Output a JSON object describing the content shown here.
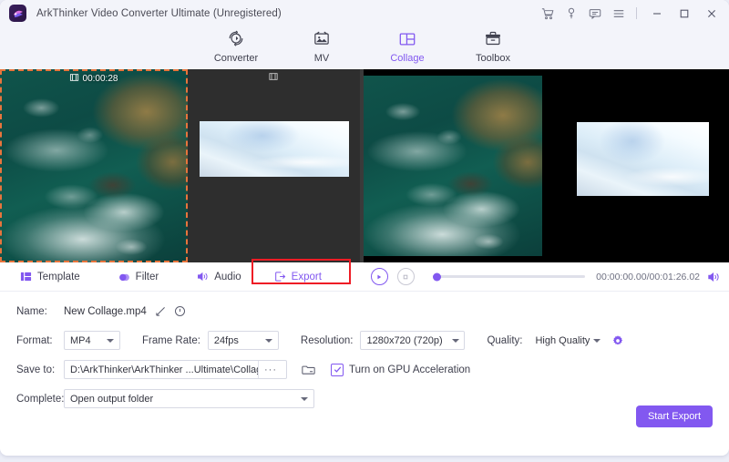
{
  "window": {
    "title": "ArkThinker Video Converter Ultimate (Unregistered)",
    "logo_icon": "arkthinker-logo-icon",
    "titlebar_icons": [
      {
        "name": "cart-icon",
        "label": "Cart"
      },
      {
        "name": "key-icon",
        "label": "Register"
      },
      {
        "name": "feedback-icon",
        "label": "Feedback"
      },
      {
        "name": "menu-icon",
        "label": "Menu"
      }
    ],
    "controls": [
      {
        "name": "minimize-button",
        "glyph": "—"
      },
      {
        "name": "maximize-button",
        "glyph": "▫"
      },
      {
        "name": "close-button",
        "glyph": "✕"
      }
    ]
  },
  "nav": {
    "items": [
      {
        "label": "Converter",
        "icon": "converter-icon",
        "active": false
      },
      {
        "label": "MV",
        "icon": "mv-icon",
        "active": false
      },
      {
        "label": "Collage",
        "icon": "collage-icon",
        "active": true
      },
      {
        "label": "Toolbox",
        "icon": "toolbox-icon",
        "active": false
      }
    ]
  },
  "preview": {
    "panes": [
      {
        "name": "pane-ocean-selected",
        "badge": "00:00:28",
        "badge_icon": "film-icon",
        "selected": true
      },
      {
        "name": "pane-sky-gray",
        "badge": "",
        "badge_icon": "film-icon",
        "selected": false
      },
      {
        "name": "pane-ocean-letterbox",
        "badge": "",
        "badge_icon": "",
        "selected": false
      },
      {
        "name": "pane-sky-black",
        "badge": "",
        "badge_icon": "",
        "selected": false
      }
    ]
  },
  "edit_tabs": [
    {
      "label": "Template",
      "icon": "template-icon",
      "active": false
    },
    {
      "label": "Filter",
      "icon": "filter-icon",
      "active": false
    },
    {
      "label": "Audio",
      "icon": "audio-icon",
      "active": false
    },
    {
      "label": "Export",
      "icon": "export-icon",
      "active": true,
      "highlighted": true
    }
  ],
  "player": {
    "play_icon": "play-icon",
    "stop_icon": "stop-icon",
    "time": "00:00:00.00/00:01:26.02",
    "volume_icon": "volume-icon",
    "progress_percent": 0
  },
  "settings": {
    "name_label": "Name:",
    "name_value": "New Collage.mp4",
    "edit_icon": "pencil-icon",
    "info_icon": "info-icon",
    "format_label": "Format:",
    "format_value": "MP4",
    "framerate_label": "Frame Rate:",
    "framerate_value": "24fps",
    "resolution_label": "Resolution:",
    "resolution_value": "1280x720 (720p)",
    "quality_label": "Quality:",
    "quality_value": "High Quality",
    "settings_gear_icon": "gear-icon",
    "saveto_label": "Save to:",
    "saveto_value": "D:\\ArkThinker\\ArkThinker ...Ultimate\\Collage Exported",
    "browse_dots": "···",
    "open_folder_icon": "folder-icon",
    "gpu_label": "Turn on GPU Acceleration",
    "gpu_checked": true,
    "complete_label": "Complete:",
    "complete_value": "Open output folder"
  },
  "footer": {
    "start_export_label": "Start Export"
  },
  "colors": {
    "accent": "#8258f0",
    "highlight": "#ee1c25",
    "selection": "#e8743c",
    "titlebar_bg": "#f3f4fa"
  }
}
